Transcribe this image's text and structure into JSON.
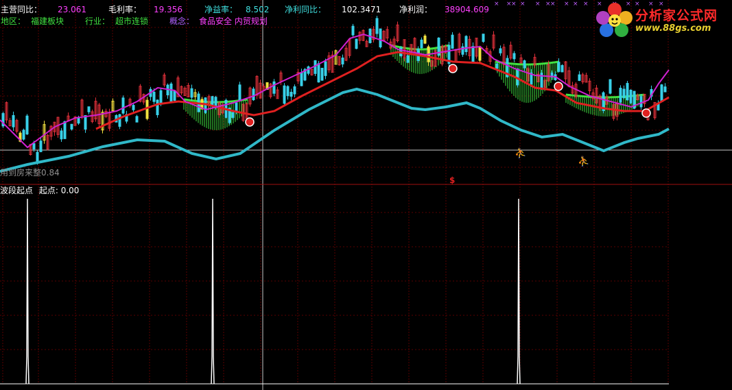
{
  "header": {
    "row1": [
      {
        "label": "主营同比：",
        "value": "23.061"
      },
      {
        "label": "毛利率：",
        "value": "19.356"
      },
      {
        "label": "净益率：",
        "value": "8.502"
      },
      {
        "label": "净利同比：",
        "value": "102.3471"
      },
      {
        "label": "净利润：",
        "value": "38904.609"
      }
    ],
    "row2": [
      {
        "label": "地区：",
        "value": "福建板块"
      },
      {
        "label": "行业：",
        "value": "超市连锁"
      },
      {
        "label": "概念：",
        "value": "食品安全 内贸规划"
      }
    ]
  },
  "logo": {
    "title": "分析家公式网",
    "url": "www.88gs.com"
  },
  "main_panel": {
    "bottom_text": "用到房来整0.84"
  },
  "sub_panel": {
    "title": "波段起点",
    "indicator_label": "起点: ",
    "indicator_value": "0.00"
  },
  "markers": {
    "dollar": "$"
  },
  "colors": {
    "background": "#000000",
    "grid": "#5a0000",
    "candle_up": "#e0303a",
    "candle_down": "#38d0e8",
    "candle_hl": "#f0e040",
    "ma_short": "#d020d0",
    "ma_mid": "#e82020",
    "ma_long": "#30b8c8",
    "cloud": "#40e040",
    "label_white": "#ffffff",
    "value_magenta": "#ff40ff",
    "label_cyan": "#40e0e0",
    "label_green": "#40e040",
    "label_purple": "#b060ff",
    "spike": "#ffffff"
  }
}
